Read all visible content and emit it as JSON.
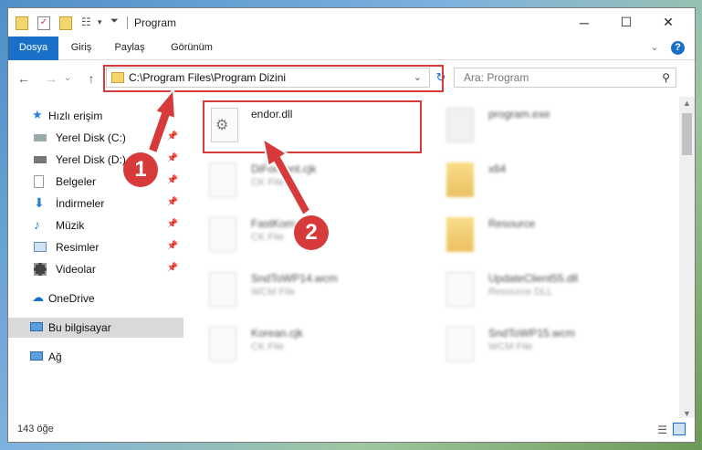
{
  "window": {
    "title": "Program"
  },
  "ribbon": {
    "tabs": [
      {
        "label": "Dosya"
      },
      {
        "label": "Giriş"
      },
      {
        "label": "Paylaş"
      },
      {
        "label": "Görünüm"
      }
    ]
  },
  "address": {
    "path": "C:\\Program Files\\Program Dizini"
  },
  "search": {
    "placeholder": "Ara: Program"
  },
  "sidebar": {
    "items": [
      {
        "label": "Hızlı erişim"
      },
      {
        "label": "Yerel Disk (C:)"
      },
      {
        "label": "Yerel Disk (D:)"
      },
      {
        "label": "Belgeler"
      },
      {
        "label": "İndirmeler"
      },
      {
        "label": "Müzik"
      },
      {
        "label": "Resimler"
      },
      {
        "label": "Videolar"
      },
      {
        "label": "OneDrive"
      },
      {
        "label": "Bu bilgisayar"
      },
      {
        "label": "Ağ"
      }
    ]
  },
  "files": [
    {
      "name": "endor.dll",
      "type": ""
    },
    {
      "name": "program.exe",
      "type": ""
    },
    {
      "name": "DiForFont.cjk",
      "type": "CK File"
    },
    {
      "name": "x64",
      "type": ""
    },
    {
      "name": "FastKom",
      "type": "CK File"
    },
    {
      "name": "Resource",
      "type": ""
    },
    {
      "name": "SndToWP14.wcm",
      "type": "WCM File"
    },
    {
      "name": "UpdateClient55.dll",
      "type": "Resource DLL"
    },
    {
      "name": "Korean.cjk",
      "type": "CK File"
    },
    {
      "name": "SndToWP15.wcm",
      "type": "WCM File"
    }
  ],
  "status": {
    "item_count": "143 öğe"
  },
  "annotations": {
    "step1": "1",
    "step2": "2"
  },
  "colors": {
    "accent": "#1a6fc9",
    "callout": "#d63a3a"
  }
}
